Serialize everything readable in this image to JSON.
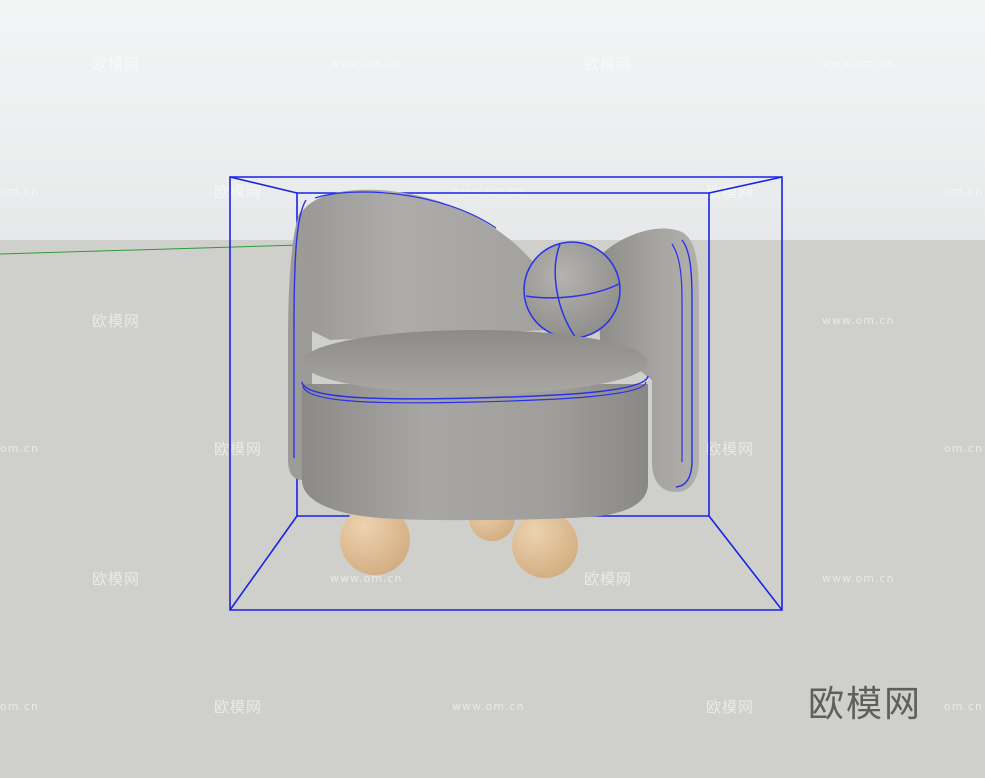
{
  "watermark": {
    "cn": "欧模网",
    "url": "www.om.cn",
    "url_cut": "om.cn"
  },
  "logo": {
    "text": "欧模网"
  },
  "colors": {
    "sky": "#eceeef",
    "ground": "#cfd0cb",
    "selection": "#1a22e6",
    "fabric": "#a09e9b",
    "legs": "#e1c096",
    "green_axis": "#2e9a3a"
  }
}
